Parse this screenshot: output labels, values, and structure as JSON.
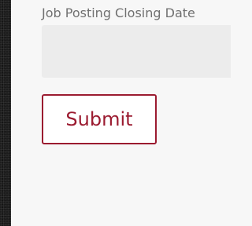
{
  "form": {
    "closing_date_field": {
      "label": "Job Posting Closing Date",
      "value": ""
    },
    "submit_label": "Submit"
  },
  "colors": {
    "accent": "#9b1b30",
    "label_text": "#707070",
    "input_background": "#ececec",
    "page_background": "#f7f7f7"
  }
}
